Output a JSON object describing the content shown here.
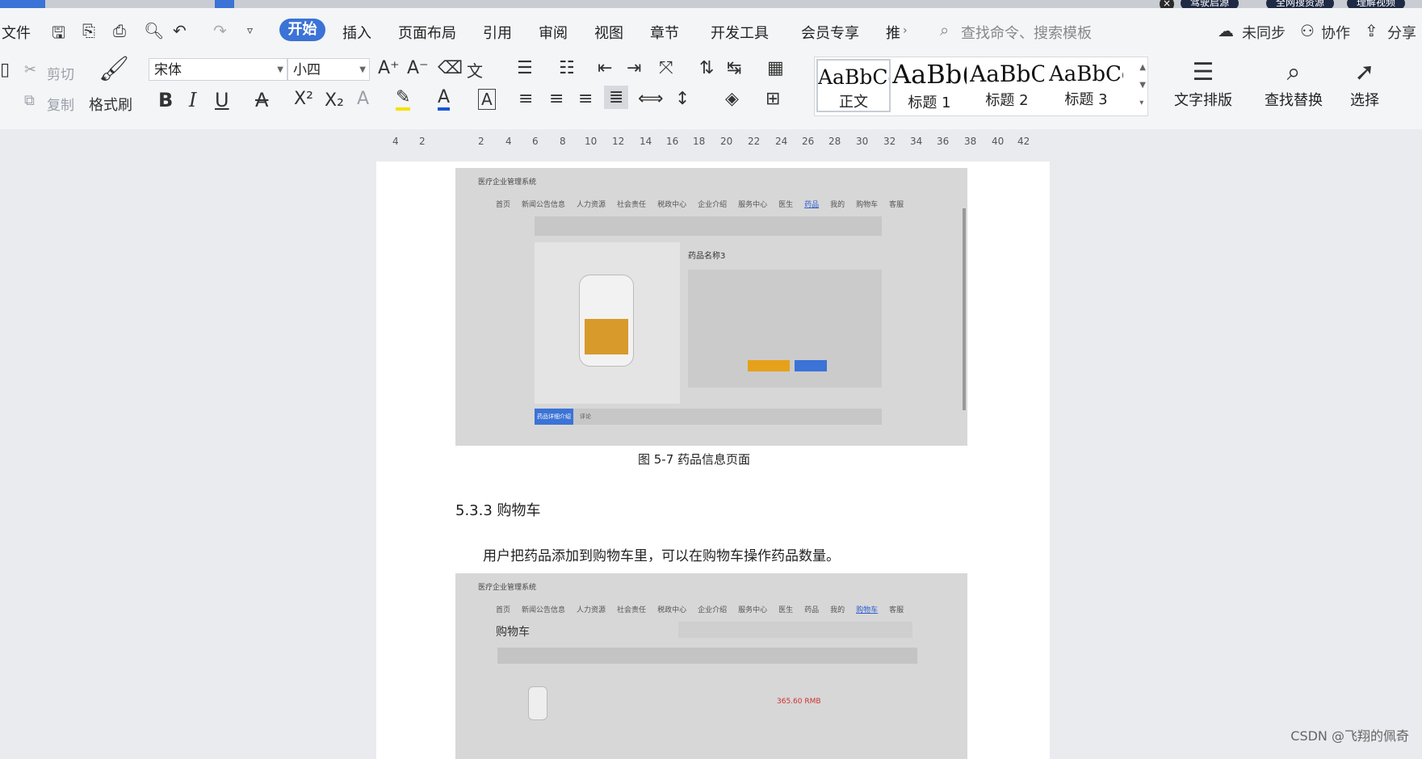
{
  "window": {
    "top_pills": [
      "驾驶启源",
      "全网搜资源",
      "理解视频"
    ]
  },
  "menubar": {
    "file": "文件",
    "tabs": [
      "开始",
      "插入",
      "页面布局",
      "引用",
      "审阅",
      "视图",
      "章节",
      "开发工具",
      "会员专享",
      "推"
    ],
    "active_tab": "开始",
    "search_placeholder": "查找命令、搜索模板",
    "sync": "未同步",
    "collab": "协作",
    "share": "分享"
  },
  "ribbon": {
    "cut": "剪切",
    "copy": "复制",
    "format_painter": "格式刷",
    "font_name": "宋体",
    "font_size": "小四",
    "styles": [
      {
        "sample": "AaBbCcI",
        "label": "正文"
      },
      {
        "sample": "AaBb(",
        "label": "标题 1"
      },
      {
        "sample": "AaBbC",
        "label": "标题 2"
      },
      {
        "sample": "AaBbCc",
        "label": "标题 3"
      }
    ],
    "text_layout": "文字排版",
    "find_replace": "查找替换",
    "select": "选择"
  },
  "ruler": [
    "4",
    "2",
    "2",
    "4",
    "6",
    "8",
    "10",
    "12",
    "14",
    "16",
    "18",
    "20",
    "22",
    "24",
    "26",
    "28",
    "30",
    "32",
    "34",
    "36",
    "38",
    "40",
    "42"
  ],
  "document": {
    "shot1": {
      "brand": "医疗企业管理系统",
      "nav": [
        "首页",
        "新闻公告信息",
        "人力资源",
        "社会责任",
        "税政中心",
        "企业介绍",
        "服务中心",
        "医生",
        "药品",
        "我的",
        "购物车",
        "客服"
      ],
      "drug_title": "药品名称3",
      "tab_active": "药品详细介绍",
      "tab2": "评论"
    },
    "caption1": "图 5-7 药品信息页面",
    "heading": "5.3.3  购物车",
    "paragraph": "用户把药品添加到购物车里，可以在购物车操作药品数量。",
    "shot2": {
      "brand": "医疗企业管理系统",
      "nav": [
        "首页",
        "新闻公告信息",
        "人力资源",
        "社会责任",
        "税政中心",
        "企业介绍",
        "服务中心",
        "医生",
        "药品",
        "我的",
        "购物车",
        "客服"
      ],
      "title": "购物车",
      "price": "365.60 RMB"
    }
  },
  "watermark": "CSDN @飞翔的佩奇"
}
